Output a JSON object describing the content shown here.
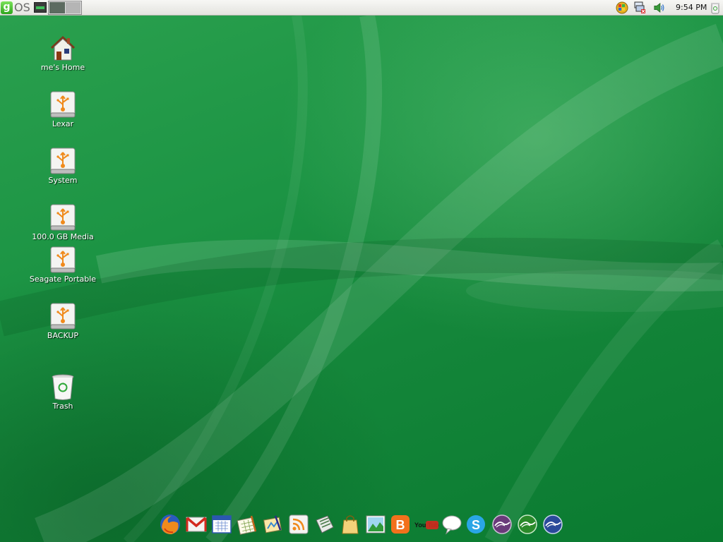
{
  "panel": {
    "logo_g": "g",
    "logo_os": "OS",
    "clock": "9:54 PM"
  },
  "desktop_icons": [
    {
      "label": "me's Home",
      "icon": "home-icon"
    },
    {
      "label": "Lexar",
      "icon": "usb-drive-icon"
    },
    {
      "label": "System",
      "icon": "usb-drive-icon"
    },
    {
      "label": "100.0 GB Media",
      "icon": "usb-drive-icon"
    },
    {
      "label": "Seagate Portable",
      "icon": "usb-drive-icon"
    },
    {
      "label": "BACKUP",
      "icon": "usb-drive-icon"
    },
    {
      "label": "Trash",
      "icon": "trash-icon"
    }
  ],
  "dock": {
    "items": [
      "firefox-icon",
      "gmail-icon",
      "calendar-icon",
      "spreadsheet-icon",
      "presentation-icon",
      "rss-reader-icon",
      "news-icon",
      "shopping-bag-icon",
      "photo-icon",
      "blogger-icon",
      "youtube-icon",
      "chat-bubble-icon",
      "skype-icon",
      "openoffice-icon",
      "openoffice-calc-icon",
      "openoffice-impress-icon"
    ],
    "youtube_label": "You Tube",
    "blogger_letter": "B",
    "skype_letter": "S"
  },
  "colors": {
    "wallpaper": "#14863a",
    "panel": "#ececea",
    "accent_orange": "#f08a1c",
    "logo_green": "#4cc43a"
  }
}
